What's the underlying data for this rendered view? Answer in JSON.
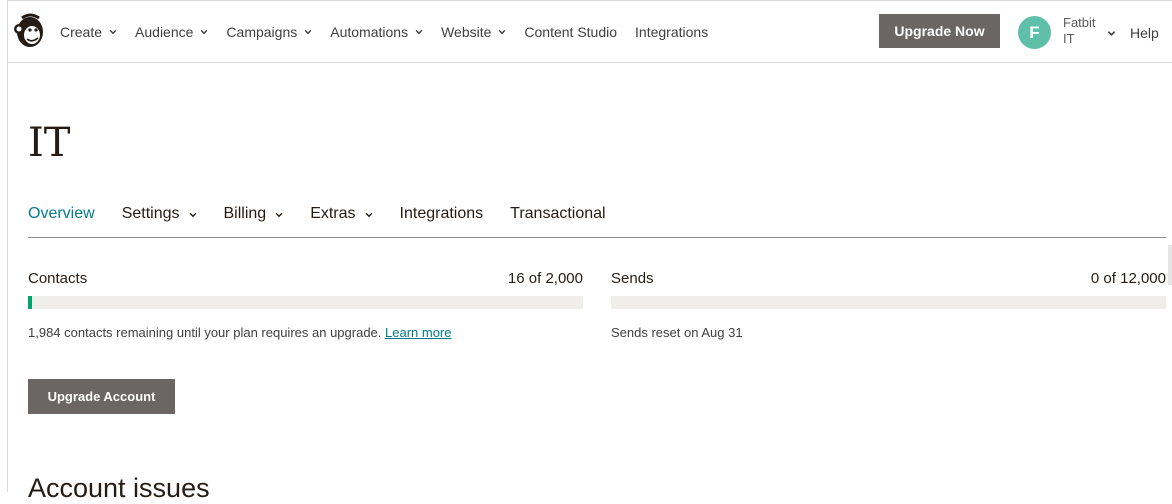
{
  "nav": {
    "items": [
      {
        "label": "Create",
        "dropdown": true
      },
      {
        "label": "Audience",
        "dropdown": true
      },
      {
        "label": "Campaigns",
        "dropdown": true
      },
      {
        "label": "Automations",
        "dropdown": true
      },
      {
        "label": "Website",
        "dropdown": true
      },
      {
        "label": "Content Studio",
        "dropdown": false
      },
      {
        "label": "Integrations",
        "dropdown": false
      }
    ],
    "upgrade_label": "Upgrade Now",
    "avatar_initial": "F",
    "user_line1": "Fatbit",
    "user_line2": "IT",
    "help_label": "Help"
  },
  "page": {
    "title": "IT"
  },
  "tabs": [
    {
      "label": "Overview",
      "active": true,
      "dropdown": false
    },
    {
      "label": "Settings",
      "active": false,
      "dropdown": true
    },
    {
      "label": "Billing",
      "active": false,
      "dropdown": true
    },
    {
      "label": "Extras",
      "active": false,
      "dropdown": true
    },
    {
      "label": "Integrations",
      "active": false,
      "dropdown": false
    },
    {
      "label": "Transactional",
      "active": false,
      "dropdown": false
    }
  ],
  "contacts": {
    "label": "Contacts",
    "used": "16",
    "of": "of",
    "limit": "2,000",
    "progress": 0.008,
    "note": "1,984 contacts remaining until your plan requires an upgrade.",
    "learn_more": "Learn more"
  },
  "sends": {
    "label": "Sends",
    "used": "0",
    "of": "of",
    "limit": "12,000",
    "progress": 0,
    "note": "Sends reset on Aug 31"
  },
  "upgrade_account_label": "Upgrade Account",
  "account_issues_heading": "Account issues",
  "colors": {
    "accent": "#007c89",
    "button": "#6b6563",
    "progress": "#00a36c",
    "avatar": "#5fbfa8"
  },
  "icons": {
    "logo": "freddie-monkey-logo",
    "dropdown": "chevron-down-icon"
  }
}
